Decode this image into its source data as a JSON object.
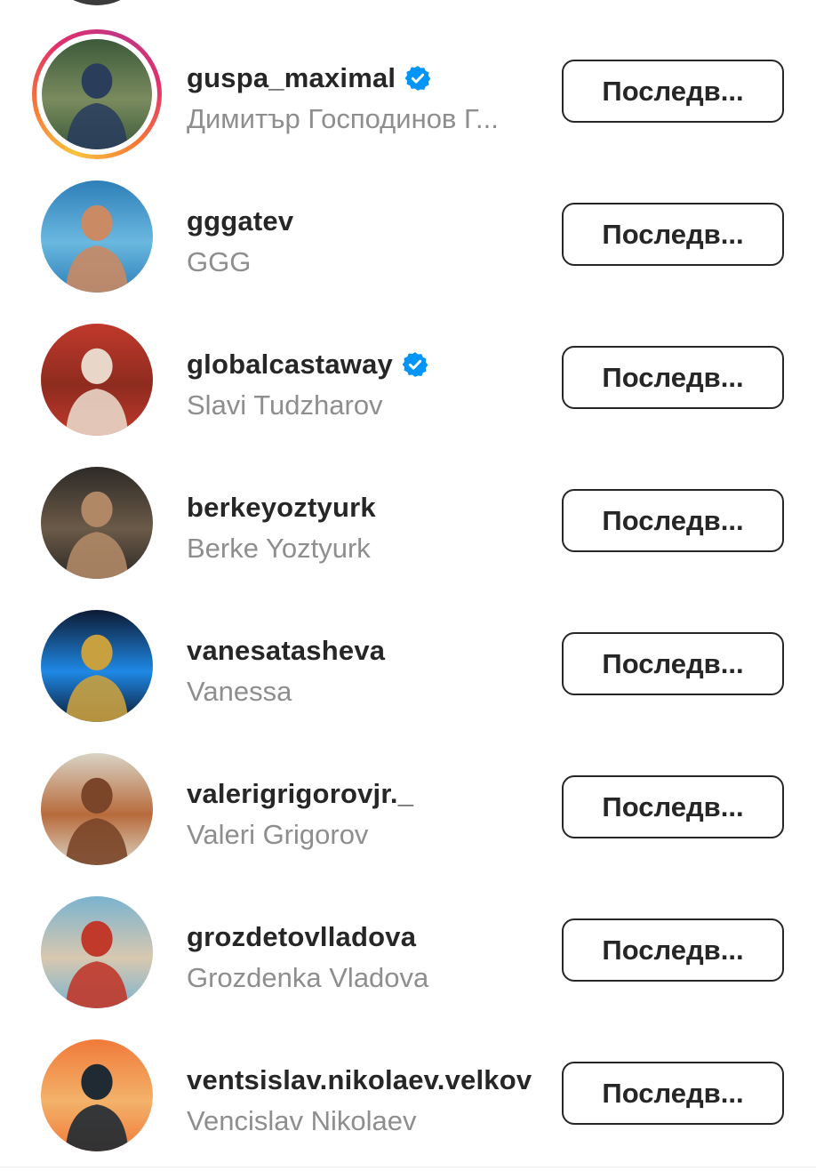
{
  "following_list": {
    "rows": [
      {
        "username": "guspa_maximal",
        "full_name": "Димитър Господинов Г...",
        "verified": true,
        "has_story": true,
        "button_label": "Последв...",
        "avatar_colors": [
          "#3c5a3a",
          "#7a8b5e",
          "#2a3e5c"
        ]
      },
      {
        "username": "gggatev",
        "full_name": "GGG",
        "verified": false,
        "has_story": false,
        "button_label": "Последв...",
        "avatar_colors": [
          "#2e7fb8",
          "#6ab8e0",
          "#c98a64"
        ]
      },
      {
        "username": "globalcastaway",
        "full_name": "Slavi Tudzharov",
        "verified": true,
        "has_story": false,
        "button_label": "Последв...",
        "avatar_colors": [
          "#c0392b",
          "#8e2b1f",
          "#e8d6c8"
        ]
      },
      {
        "username": "berkeyoztyurk",
        "full_name": "Berke Yoztyurk",
        "verified": false,
        "has_story": false,
        "button_label": "Последв...",
        "avatar_colors": [
          "#2d2a26",
          "#6b5a48",
          "#b08866"
        ]
      },
      {
        "username": "vanesatasheva",
        "full_name": "Vanessa",
        "verified": false,
        "has_story": false,
        "button_label": "Последв...",
        "avatar_colors": [
          "#0d1a33",
          "#1e88e5",
          "#c8a040"
        ]
      },
      {
        "username": "valerigrigorovjr._",
        "full_name": "Valeri Grigorov",
        "verified": false,
        "has_story": false,
        "button_label": "Последв...",
        "avatar_colors": [
          "#d9d3c4",
          "#b86b3c",
          "#7a4528"
        ]
      },
      {
        "username": "grozdetovlladova",
        "full_name": "Grozdenka Vladova",
        "verified": false,
        "has_story": false,
        "button_label": "Последв...",
        "avatar_colors": [
          "#7ab3cf",
          "#d8c8b0",
          "#c0392b"
        ]
      },
      {
        "username": "ventsislav.nikolaev.velkov",
        "full_name": "Vencislav Nikolaev",
        "verified": false,
        "has_story": false,
        "button_label": "Последв...",
        "avatar_colors": [
          "#f07a3a",
          "#f3b26a",
          "#1f2a33"
        ]
      }
    ]
  },
  "theme": {
    "text_primary": "#262626",
    "text_secondary": "#8e8e8e",
    "verified_blue": "#0095f6"
  }
}
